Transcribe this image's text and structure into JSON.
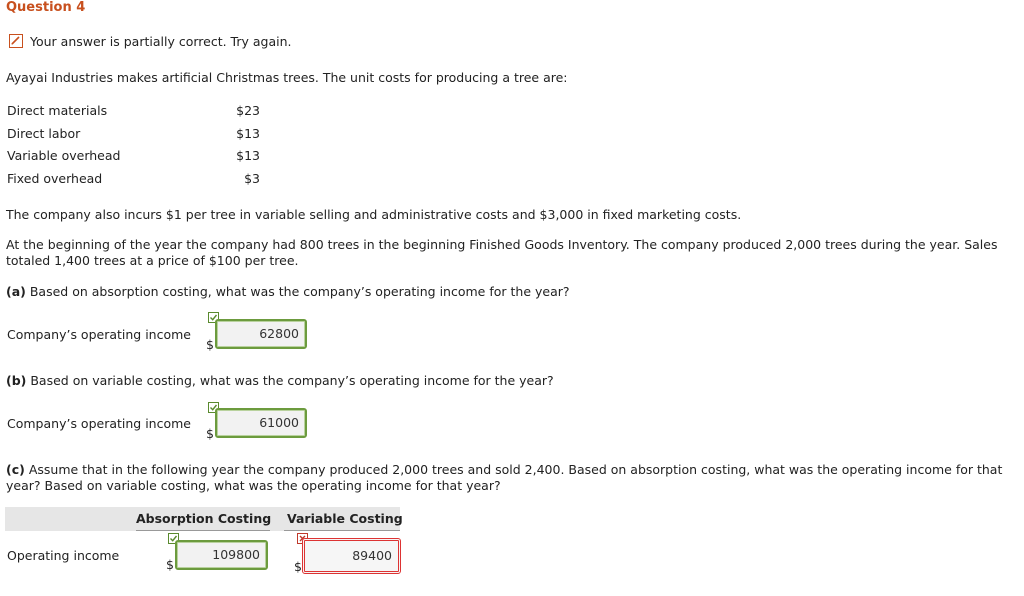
{
  "question": {
    "title": "Question 4",
    "status_text": "Your answer is partially correct.  Try again.",
    "intro": "Ayayai Industries makes artificial Christmas trees. The unit costs for producing a tree are:",
    "costs": [
      {
        "label": "Direct materials",
        "value": "$23"
      },
      {
        "label": "Direct labor",
        "value": "$13"
      },
      {
        "label": "Variable overhead",
        "value": "$13"
      },
      {
        "label": "Fixed overhead",
        "value": "$3"
      }
    ],
    "para1": "The company also incurs $1 per tree in variable selling and administrative costs and $3,000 in fixed marketing costs.",
    "para2": "At the beginning of the year the company had 800 trees in the beginning Finished Goods Inventory. The company produced 2,000 trees during the year. Sales totaled 1,400 trees at a price of $100 per tree."
  },
  "part_a": {
    "tag": "(a)",
    "text": " Based on absorption costing, what was the company’s operating income for the year?",
    "label": "Company’s operating income",
    "currency": "$",
    "value": "62800"
  },
  "part_b": {
    "tag": "(b)",
    "text": " Based on variable costing, what was the company’s operating income for the year?",
    "label": "Company’s operating income",
    "currency": "$",
    "value": "61000"
  },
  "part_c": {
    "tag": "(c)",
    "text": " Assume that in the following year the company produced 2,000 trees and sold 2,400. Based on absorption costing, what was the operating income for that year? Based on variable costing, what was the operating income for that year?",
    "col_absorption": "Absorption Costing",
    "col_variable": "Variable Costing",
    "row_label": "Operating income",
    "currency": "$",
    "absorption_value": "109800",
    "variable_value": "89400"
  },
  "colors": {
    "title": "#c8501e",
    "correct": "#6c9b3e",
    "incorrect": "#d33333"
  }
}
